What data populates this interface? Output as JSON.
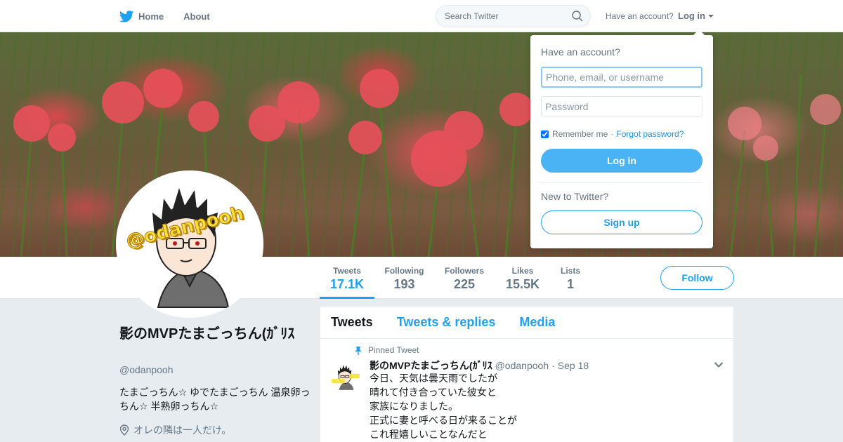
{
  "nav": {
    "home_label": "Home",
    "about_label": "About",
    "search_placeholder": "Search Twitter",
    "have_account_text": "Have an account?",
    "login_label": "Log in"
  },
  "stats": [
    {
      "label": "Tweets",
      "value": "17.1K",
      "active": true
    },
    {
      "label": "Following",
      "value": "193"
    },
    {
      "label": "Followers",
      "value": "225"
    },
    {
      "label": "Likes",
      "value": "15.5K"
    },
    {
      "label": "Lists",
      "value": "1"
    }
  ],
  "follow_label": "Follow",
  "profile": {
    "name": "影のMVPたまごっちん(ｶﾞﾘｽ",
    "handle": "@odanpooh",
    "bio": "たまごっちん☆ ゆでたまごっちん 温泉卵っちん☆ 半熟卵っちん☆",
    "location": "オレの隣は一人だけ。",
    "avatar_text": "@odanpooh"
  },
  "timeline": {
    "tabs": [
      "Tweets",
      "Tweets & replies",
      "Media"
    ],
    "pinned_label": "Pinned Tweet",
    "tweet": {
      "name": "影のMVPたまごっちん(ｶﾞﾘｽ",
      "handle": "@odanpooh",
      "separator": "·",
      "time": "Sep 18",
      "lines": [
        "今日、天気は曇天雨でしたが",
        "晴れて付き合っていた彼女と",
        "家族になりました。",
        "正式に妻と呼べる日が来ることが",
        "これ程嬉しいことなんだと"
      ]
    }
  },
  "login_dropdown": {
    "title": "Have an account?",
    "username_placeholder": "Phone, email, or username",
    "password_placeholder": "Password",
    "remember_label": "Remember me",
    "separator": "·",
    "forgot_label": "Forgot password?",
    "login_button": "Log in",
    "new_prompt": "New to Twitter?",
    "signup_button": "Sign up"
  },
  "colors": {
    "accent": "#1da1f2",
    "login_button_bg": "#4ab3f4",
    "page_bg": "#e6ecf0",
    "muted_text": "#657786"
  }
}
